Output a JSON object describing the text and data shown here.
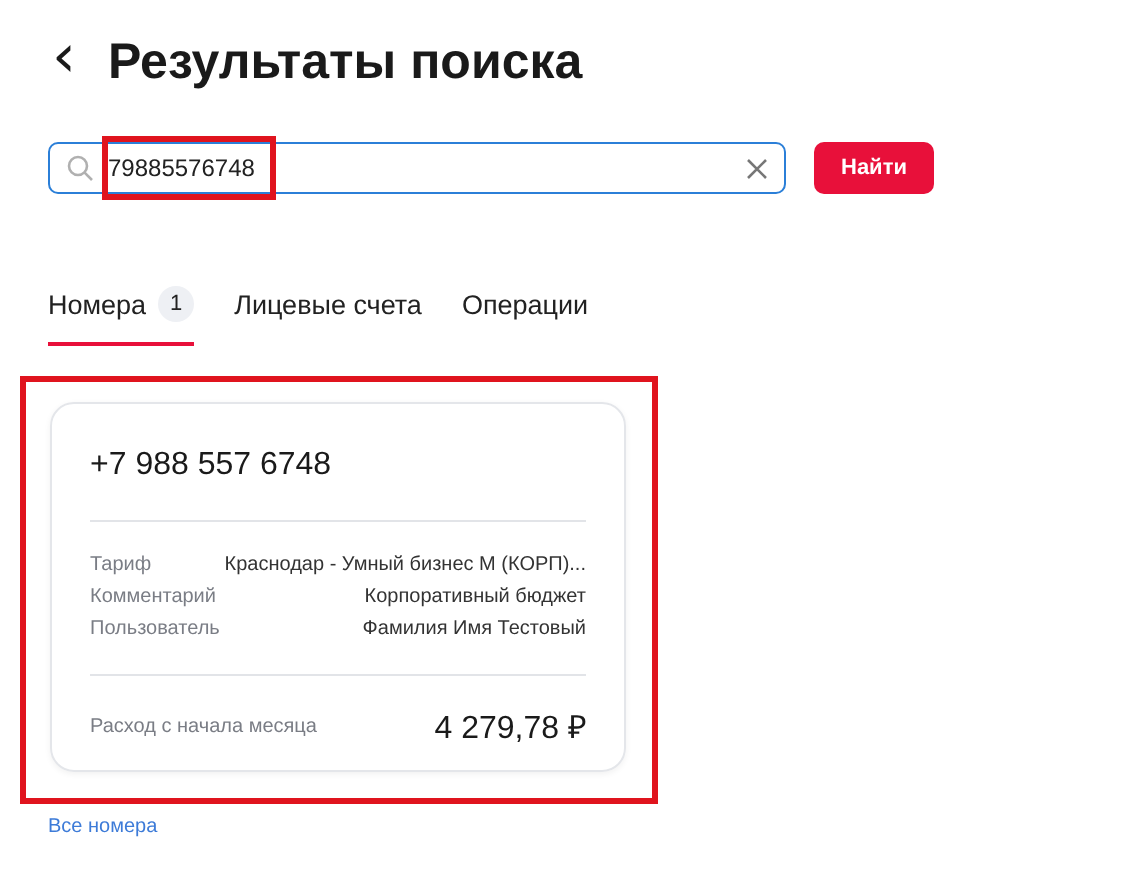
{
  "header": {
    "back": "‹",
    "title": "Результаты поиска"
  },
  "search": {
    "value": "79885576748",
    "highlighted": true,
    "button": "Найти"
  },
  "tabs": [
    {
      "label": "Номера",
      "count": "1",
      "selected": true
    },
    {
      "label": "Лицевые счета",
      "selected": false
    },
    {
      "label": "Операции",
      "selected": false
    }
  ],
  "card": {
    "highlighted": true,
    "phone": "+7 988 557 6748",
    "details": [
      {
        "label": "Тариф",
        "value": "Краснодар - Умный бизнес М (КОРП)..."
      },
      {
        "label": "Комментарий",
        "value": "Корпоративный бюджет"
      },
      {
        "label": "Пользователь",
        "value": "Фамилия Имя Тестовый"
      }
    ],
    "expense_label": "Расход с начала месяца",
    "expense_value": "4 279,78 ₽"
  },
  "all_link": "Все номера"
}
